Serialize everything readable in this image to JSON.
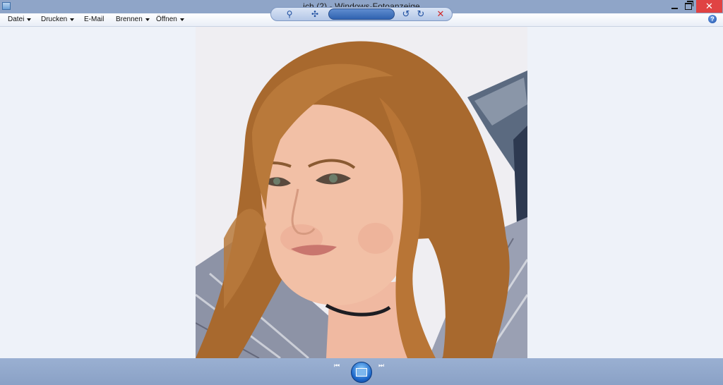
{
  "window": {
    "title": "ich (2) - Windows-Fotoanzeige",
    "close_glyph": "✕"
  },
  "menu": {
    "items": [
      {
        "label": "Datei"
      },
      {
        "label": "Drucken"
      },
      {
        "label": "E-Mail"
      },
      {
        "label": "Brennen"
      },
      {
        "label": "Öffnen"
      }
    ],
    "help_glyph": "?"
  },
  "toolbar": {
    "zoom_glyph": "⚲",
    "fit_glyph": "✣",
    "previous_glyph": "⏮",
    "next_glyph": "⏭",
    "rotate_left_glyph": "↺",
    "rotate_right_glyph": "↻",
    "delete_glyph": "✕"
  },
  "photo": {
    "description_icon": "portrait-photo"
  }
}
